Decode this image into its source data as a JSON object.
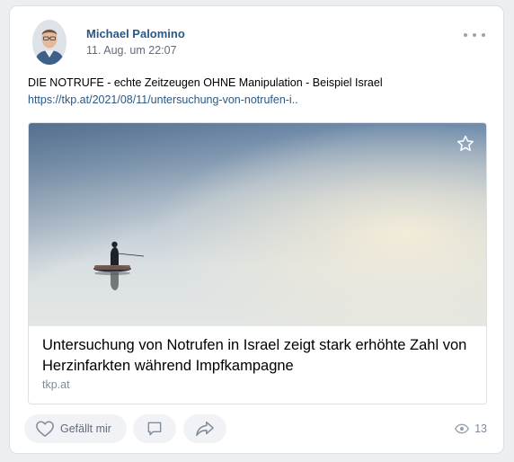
{
  "post": {
    "author": "Michael Palomino",
    "date": "11. Aug. um 22:07",
    "text": "DIE NOTRUFE - echte Zeitzeugen OHNE Manipulation - Beispiel Israel",
    "link": "https://tkp.at/2021/08/11/untersuchung-von-notrufen-i.."
  },
  "attachment": {
    "title": "Untersuchung von Notrufen in Israel zeigt stark erhöhte Zahl von Herzinfarkten während Impfkampagne",
    "domain": "tkp.at"
  },
  "actions": {
    "like_label": "Gefällt mir",
    "views": "13"
  },
  "icons": [
    "more-icon",
    "star-icon",
    "heart-icon",
    "comment-icon",
    "share-icon",
    "eye-icon"
  ],
  "colors": {
    "link": "#2a5885",
    "secondary_text": "#626d7a",
    "button_bg": "#f0f2f5"
  }
}
